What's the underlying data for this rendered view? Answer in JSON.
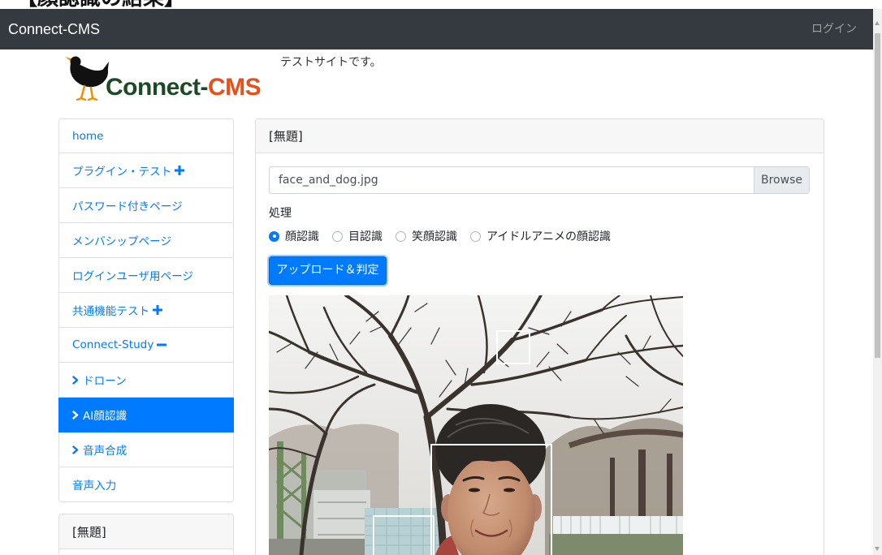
{
  "document": {
    "heading": "【顔認識の結果】"
  },
  "colors": {
    "navbar_bg": "#343a40",
    "accent": "#007bff",
    "logo_main": "#1b4a25",
    "logo_accent": "#e8501a"
  },
  "navbar": {
    "brand": "Connect-CMS",
    "login": "ログイン"
  },
  "site_header": {
    "logo": {
      "icon": "bird-icon",
      "text_main": "Connect-",
      "text_accent": "CMS"
    },
    "description": "テストサイトです。"
  },
  "sidebar": {
    "menu": [
      {
        "label": "home"
      },
      {
        "label": "プラグイン・テスト",
        "trailing_icon": "plus-icon"
      },
      {
        "label": "パスワード付きページ"
      },
      {
        "label": "メンバシップページ"
      },
      {
        "label": "ログインユーザ用ページ"
      },
      {
        "label": "共通機能テスト",
        "trailing_icon": "plus-icon"
      },
      {
        "label": "Connect-Study",
        "trailing_icon": "minus-icon"
      },
      {
        "label": "ドローン",
        "leading_icon": "chevron-right-icon"
      },
      {
        "label": "AI顔認識",
        "leading_icon": "chevron-right-icon",
        "active": true
      },
      {
        "label": "音声合成",
        "leading_icon": "chevron-right-icon"
      },
      {
        "label": "音声入力"
      }
    ],
    "frame": {
      "title": "[無題]"
    }
  },
  "main": {
    "frame": {
      "title": "[無題]"
    },
    "file_input": {
      "value": "face_and_dog.jpg",
      "browse_label": "Browse"
    },
    "process": {
      "label": "処理",
      "options": [
        {
          "label": "顔認識",
          "checked": true
        },
        {
          "label": "目認識",
          "checked": false
        },
        {
          "label": "笑顔認識",
          "checked": false
        },
        {
          "label": "アイドルアニメの顔認識",
          "checked": false
        }
      ]
    },
    "submit_label": "アップロード＆判定"
  }
}
